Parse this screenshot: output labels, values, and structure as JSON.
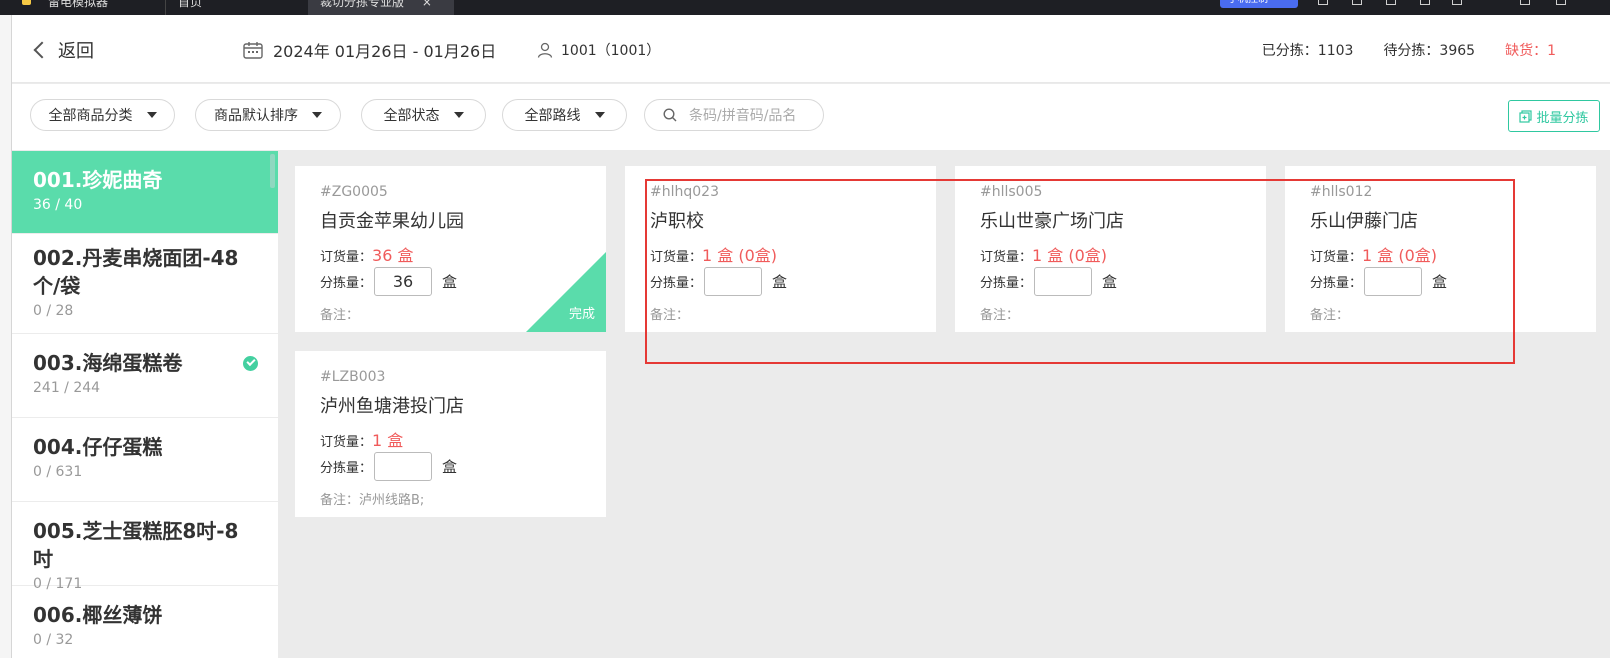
{
  "titlebar": {
    "tabs": [
      {
        "label": "雷电模拟器"
      },
      {
        "label": "首页"
      },
      {
        "label": "裁切分拣专业版"
      }
    ],
    "badge": "手机控制"
  },
  "header": {
    "back_label": "返回",
    "date_range": "2024年 01月26日 - 01月26日",
    "user": "1001（1001）",
    "sorted_label": "已分拣：1103",
    "pending_label": "待分拣：3965",
    "shortage_label": "缺货：1"
  },
  "filters": {
    "category": "全部商品分类",
    "sort": "商品默认排序",
    "status": "全部状态",
    "route": "全部路线",
    "search_placeholder": "条码/拼音码/品名",
    "batch_label": "批量分拣"
  },
  "sidebar": {
    "items": [
      {
        "name": "001.珍妮曲奇",
        "count": "36 / 40",
        "active": true
      },
      {
        "name": "002.丹麦串烧面团-48个/袋",
        "count": "0 / 28"
      },
      {
        "name": "003.海绵蛋糕卷",
        "count": "241 / 244",
        "complete": true
      },
      {
        "name": "004.仔仔蛋糕",
        "count": "0 / 631"
      },
      {
        "name": "005.芝士蛋糕胚8吋-8吋",
        "count": "0 / 171"
      },
      {
        "name": "006.椰丝薄饼",
        "count": "0 / 32"
      }
    ]
  },
  "cards": [
    {
      "code": "#ZG0005",
      "store": "自贡金苹果幼儿园",
      "order_label": "订货量：",
      "order_value": "36 盒",
      "pick_label": "分拣量：",
      "pick_value": "36",
      "unit": "盒",
      "note": "备注：",
      "done_label": "完成"
    },
    {
      "code": "#hlhq023",
      "store": "泸职校",
      "order_label": "订货量：",
      "order_value": "1 盒 (0盒)",
      "pick_label": "分拣量：",
      "pick_value": "",
      "unit": "盒",
      "note": "备注："
    },
    {
      "code": "#hlls005",
      "store": "乐山世豪广场门店",
      "order_label": "订货量：",
      "order_value": "1 盒 (0盒)",
      "pick_label": "分拣量：",
      "pick_value": "",
      "unit": "盒",
      "note": "备注："
    },
    {
      "code": "#hlls012",
      "store": "乐山伊藤门店",
      "order_label": "订货量：",
      "order_value": "1 盒 (0盒)",
      "pick_label": "分拣量：",
      "pick_value": "",
      "unit": "盒",
      "note": "备注："
    },
    {
      "code": "#LZB003",
      "store": "泸州鱼塘港投门店",
      "order_label": "订货量：",
      "order_value": "1 盒",
      "pick_label": "分拣量：",
      "pick_value": "",
      "unit": "盒",
      "note": "备注：泸州线路B;"
    }
  ],
  "colors": {
    "accent": "#5adcab",
    "alert": "#f05b5b",
    "annotation": "#e53935"
  }
}
